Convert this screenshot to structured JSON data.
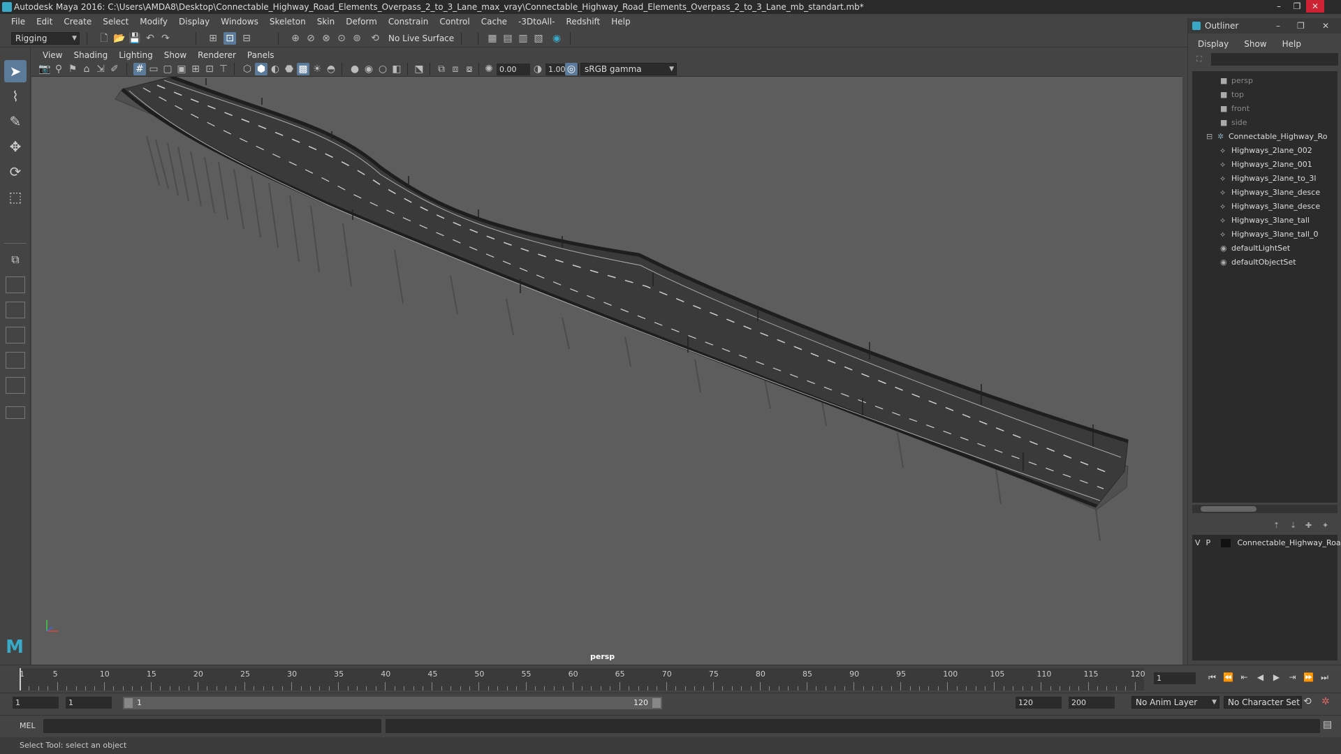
{
  "window": {
    "title": "Autodesk Maya 2016: C:\\Users\\AMDA8\\Desktop\\Connectable_Highway_Road_Elements_Overpass_2_to_3_Lane_max_vray\\Connectable_Highway_Road_Elements_Overpass_2_to_3_Lane_mb_standart.mb*"
  },
  "menu": [
    "File",
    "Edit",
    "Create",
    "Select",
    "Modify",
    "Display",
    "Windows",
    "Skeleton",
    "Skin",
    "Deform",
    "Constrain",
    "Control",
    "Cache",
    "-3DtoAll-",
    "Redshift",
    "Help"
  ],
  "shelf": {
    "mode": "Rigging",
    "live_surface": "No Live Surface"
  },
  "viewport": {
    "menu": [
      "View",
      "Shading",
      "Lighting",
      "Show",
      "Renderer",
      "Panels"
    ],
    "exposure": "0.00",
    "gamma": "1.00",
    "color_space": "sRGB gamma",
    "camera": "persp"
  },
  "outliner": {
    "title": "Outliner",
    "menu": [
      "Display",
      "Show",
      "Help"
    ],
    "cameras": [
      "persp",
      "top",
      "front",
      "side"
    ],
    "group": "Connectable_Highway_Ro",
    "children": [
      "Highways_2lane_002",
      "Highways_2lane_001",
      "Highways_2lane_to_3l",
      "Highways_3lane_desce",
      "Highways_3lane_desce",
      "Highways_3lane_tall",
      "Highways_3lane_tall_0"
    ],
    "sets": [
      "defaultLightSet",
      "defaultObjectSet"
    ]
  },
  "layers": {
    "v": "V",
    "p": "P",
    "name": "Connectable_Highway_Road"
  },
  "timeline": {
    "ticks": [
      "5",
      "10",
      "15",
      "20",
      "25",
      "30",
      "35",
      "40",
      "45",
      "50",
      "55",
      "60",
      "65",
      "70",
      "75",
      "80",
      "85",
      "90",
      "95",
      "100",
      "105",
      "110",
      "115",
      "120"
    ],
    "first_label": "1",
    "current_frame": "1"
  },
  "range": {
    "start": "1",
    "start2": "1",
    "slider_start": "1",
    "slider_end": "120",
    "end": "120",
    "end2": "200",
    "anim_layer": "No Anim Layer",
    "character_set": "No Character Set"
  },
  "command": {
    "lang": "MEL"
  },
  "status": {
    "text": "Select Tool: select an object"
  },
  "colors": {
    "accent": "#5c7a99",
    "viewport_bg": "#5d5d5d",
    "panel_bg": "#444444"
  }
}
